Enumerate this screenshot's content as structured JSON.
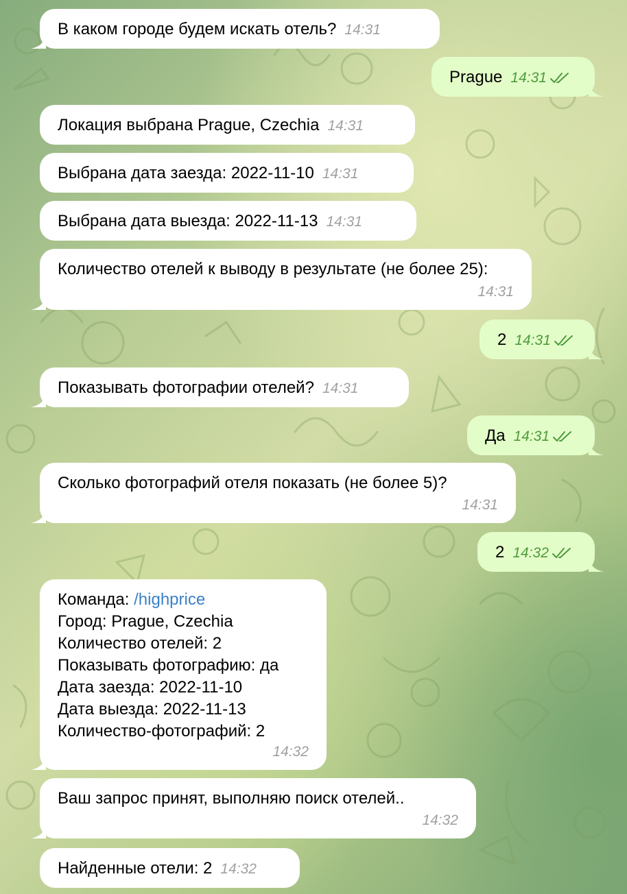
{
  "messages": [
    {
      "text": "В каком городе будем искать отель?",
      "time": "14:31"
    },
    {
      "text": "Prague",
      "time": "14:31"
    },
    {
      "text": "Локация выбрана Prague, Czechia",
      "time": "14:31"
    },
    {
      "text": "Выбрана дата заезда: 2022-11-10",
      "time": "14:31"
    },
    {
      "text": "Выбрана дата выезда: 2022-11-13",
      "time": "14:31"
    },
    {
      "text": "Количество отелей к выводу в результате (не более 25):",
      "time": "14:31"
    },
    {
      "text": "2",
      "time": "14:31"
    },
    {
      "text": "Показывать фотографии отелей?",
      "time": "14:31"
    },
    {
      "text": "Да",
      "time": "14:31"
    },
    {
      "text": "Сколько фотографий отеля показать (не более 5)?",
      "time": "14:31"
    },
    {
      "text": "2",
      "time": "14:32"
    },
    {
      "command_label": "Команда: ",
      "command": "/highprice",
      "lines": [
        "Город: Prague, Czechia",
        "Количество отелей: 2",
        "Показывать фотографию: да",
        "Дата заезда: 2022-11-10",
        "Дата выезда: 2022-11-13",
        "Количество-фотографий: 2"
      ],
      "time": "14:32"
    },
    {
      "text": "Ваш запрос принят, выполняю поиск отелей..",
      "time": "14:32"
    },
    {
      "text": "Найденные отели: 2",
      "time": "14:32"
    }
  ],
  "colors": {
    "incoming": "#ffffff",
    "outgoing": "#e3fdc9",
    "time_out": "#4d9a3b",
    "link": "#3a81c8"
  }
}
